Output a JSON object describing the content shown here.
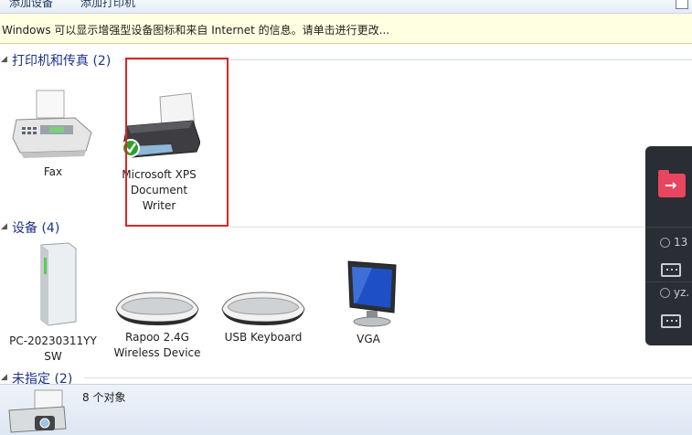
{
  "toolbar": {
    "add_device_label": "添加设备",
    "add_printer_label": "添加打印机"
  },
  "infobar": {
    "message": "Windows 可以显示增强型设备图标和来自 Internet 的信息。请单击进行更改..."
  },
  "groups": {
    "printers": {
      "title": "打印机和传真 (2)"
    },
    "devices": {
      "title": "设备 (4)"
    },
    "unspecified": {
      "title": "未指定 (2)"
    }
  },
  "printers": [
    {
      "name": "Fax",
      "icon": "fax-icon"
    },
    {
      "name": "Microsoft XPS Document Writer",
      "icon": "printer-icon",
      "default": true
    }
  ],
  "devices": [
    {
      "name": "PC-20230311YY SW",
      "icon": "computer-tower-icon"
    },
    {
      "name": "Rapoo 2.4G Wireless Device",
      "icon": "keyboard-icon"
    },
    {
      "name": "USB Keyboard",
      "icon": "keyboard-icon"
    },
    {
      "name": "VGA",
      "icon": "monitor-icon"
    }
  ],
  "status": {
    "count": "8 个对象"
  },
  "side_panel": {
    "user1": "13",
    "user2": "yz."
  },
  "colors": {
    "group_title": "#1e3287",
    "selection": "#e02424",
    "infobar_bg": "#ffffe1",
    "panel_bg": "#2a2d33",
    "panel_accent": "#e8455f"
  }
}
